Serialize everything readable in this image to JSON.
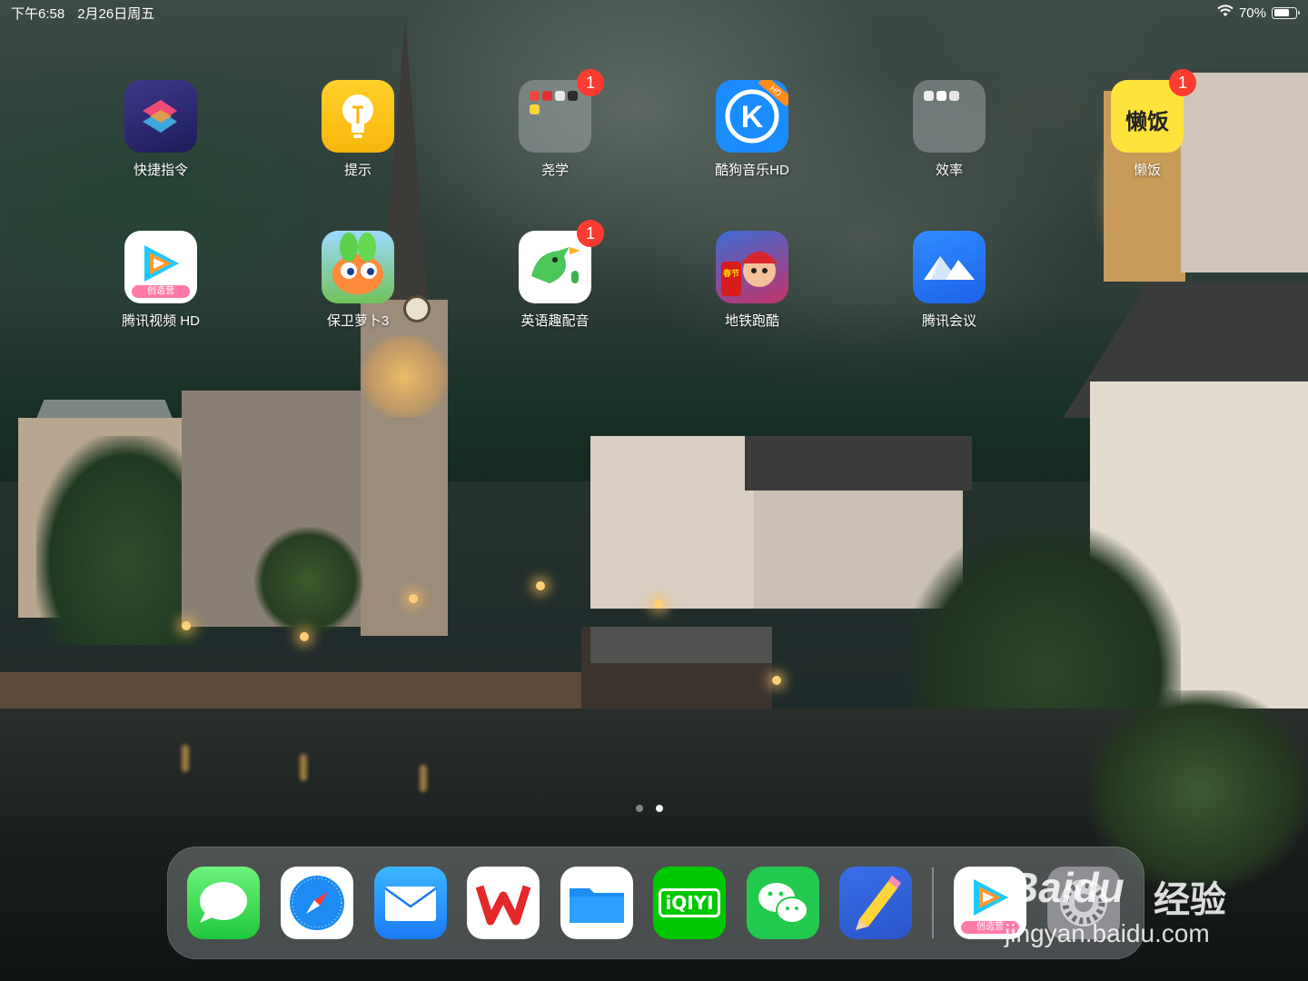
{
  "statusbar": {
    "time": "下午6:58",
    "date": "2月26日周五",
    "battery_pct": "70%",
    "battery_level": 0.7
  },
  "home_apps": [
    {
      "label": "快捷指令",
      "icon": "shortcuts-icon"
    },
    {
      "label": "提示",
      "icon": "tips-lightbulb-icon"
    },
    {
      "label": "尧学",
      "icon": "folder-icon",
      "badge": "1"
    },
    {
      "label": "酷狗音乐HD",
      "icon": "kugou-k-icon",
      "icon_corner": "HD"
    },
    {
      "label": "效率",
      "icon": "folder-icon"
    },
    {
      "label": "懒饭",
      "icon": "lanfan-icon",
      "icon_text": "懒饭",
      "badge": "1"
    },
    {
      "label": "腾讯视频 HD",
      "icon": "tencent-video-icon",
      "icon_text": "创造营"
    },
    {
      "label": "保卫萝卜3",
      "icon": "carrot-icon"
    },
    {
      "label": "英语趣配音",
      "icon": "bird-icon",
      "badge": "1"
    },
    {
      "label": "地铁跑酷",
      "icon": "subway-surfers-icon",
      "icon_text": "春节"
    },
    {
      "label": "腾讯会议",
      "icon": "tencent-meeting-icon"
    }
  ],
  "page_indicator": {
    "count": 2,
    "current": 2
  },
  "dock": [
    {
      "name": "messages",
      "icon": "messages-bubble-icon"
    },
    {
      "name": "safari",
      "icon": "safari-compass-icon"
    },
    {
      "name": "mail",
      "icon": "mail-envelope-icon"
    },
    {
      "name": "wps",
      "icon": "wps-w-icon"
    },
    {
      "name": "files",
      "icon": "files-folder-icon"
    },
    {
      "name": "iqiyi",
      "icon": "iqiyi-icon",
      "text": "iQIYI"
    },
    {
      "name": "wechat",
      "icon": "wechat-icon"
    },
    {
      "name": "goodnotes",
      "icon": "pencil-icon"
    },
    {
      "name": "tencent-video",
      "icon": "tencent-video-icon",
      "text": "创造营"
    },
    {
      "name": "settings",
      "icon": "settings-gear-icon"
    }
  ],
  "watermark": {
    "logo": "Baidu",
    "cn": "经验",
    "url": "jingyan.baidu.com"
  },
  "colors": {
    "badge": "#fe3b30",
    "kugou": "#1a8cff",
    "lanfan": "#ffe33c",
    "iqiyi": "#00c800",
    "wechat": "#24c94f"
  }
}
